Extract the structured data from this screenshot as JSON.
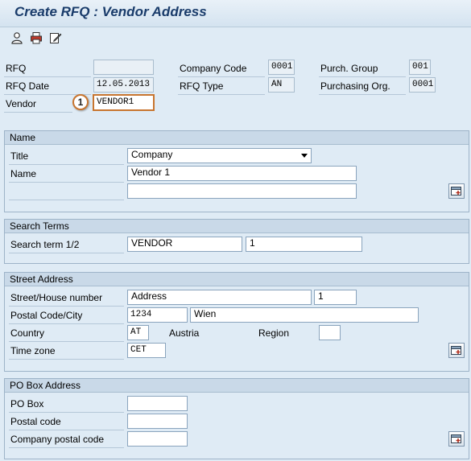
{
  "window": {
    "title": "Create RFQ : Vendor Address"
  },
  "toolbar": {
    "icons": [
      "person-icon",
      "print-icon",
      "edit-icon"
    ]
  },
  "header": {
    "rfq_label": "RFQ",
    "rfq_value": "",
    "rfq_date_label": "RFQ Date",
    "rfq_date_value": "12.05.2013",
    "vendor_label": "Vendor",
    "vendor_value": "VENDOR1",
    "company_code_label": "Company Code",
    "company_code_value": "0001",
    "rfq_type_label": "RFQ Type",
    "rfq_type_value": "AN",
    "purch_group_label": "Purch. Group",
    "purch_group_value": "001",
    "purch_org_label": "Purchasing Org.",
    "purch_org_value": "0001",
    "callout_number": "1"
  },
  "name_group": {
    "heading": "Name",
    "title_label": "Title",
    "title_value": "Company",
    "name_label": "Name",
    "name_value": "Vendor 1",
    "name2_value": ""
  },
  "search_group": {
    "heading": "Search Terms",
    "label": "Search term 1/2",
    "term1": "VENDOR",
    "term2": "1"
  },
  "street_group": {
    "heading": "Street Address",
    "street_label": "Street/House number",
    "street_value": "Address",
    "house_value": "1",
    "postal_label": "Postal Code/City",
    "postal_value": "1234",
    "city_value": "Wien",
    "country_label": "Country",
    "country_value": "AT",
    "country_name": "Austria",
    "region_label": "Region",
    "region_value": "",
    "timezone_label": "Time zone",
    "timezone_value": "CET"
  },
  "pobox_group": {
    "heading": "PO Box Address",
    "pobox_label": "PO Box",
    "pobox_value": "",
    "postal_label": "Postal code",
    "postal_value": "",
    "company_postal_label": "Company postal code",
    "company_postal_value": ""
  },
  "colors": {
    "background": "#dfebf5",
    "title": "#1a3c6b",
    "callout": "#c8752f"
  }
}
